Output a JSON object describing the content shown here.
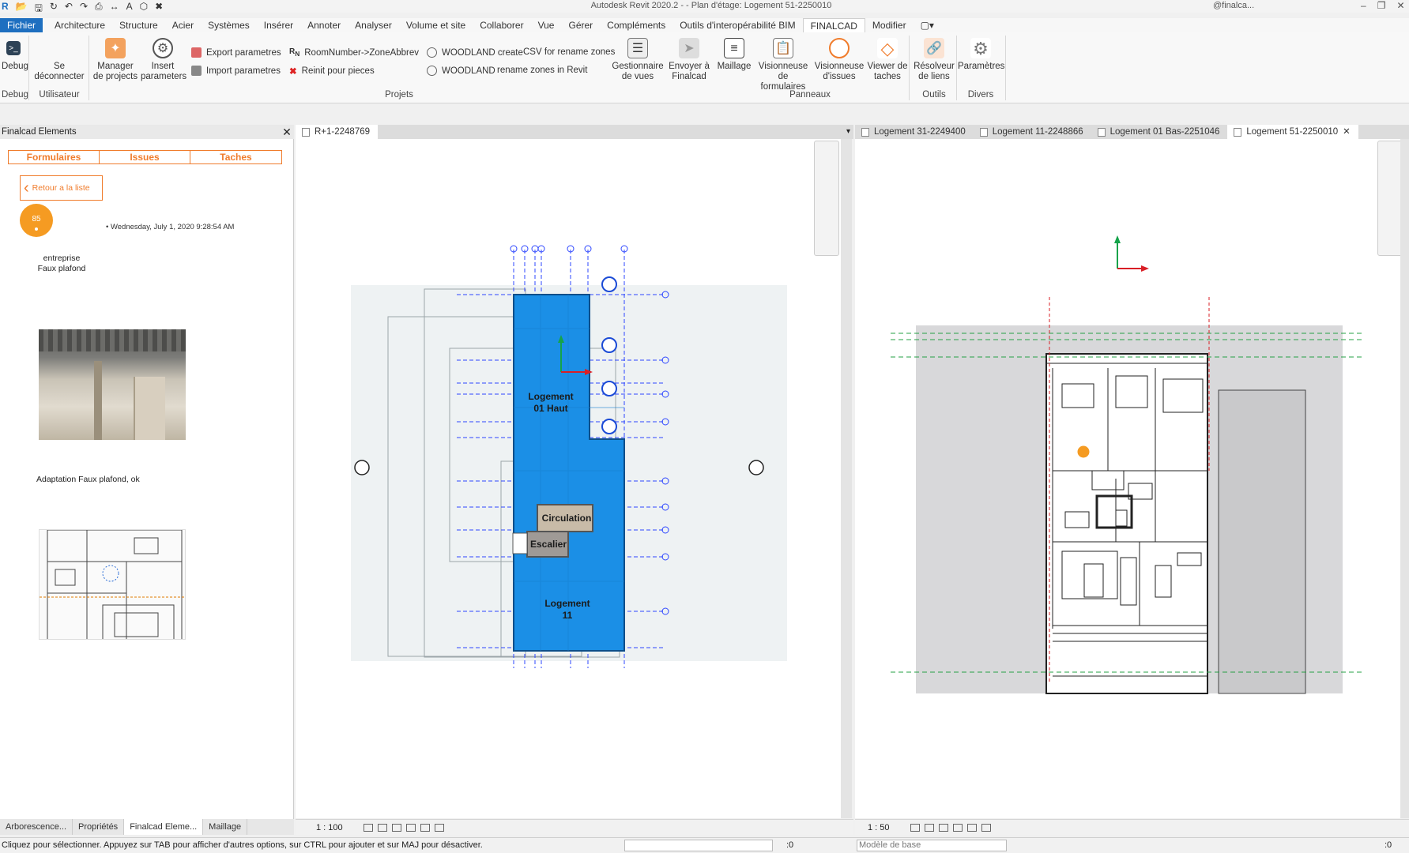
{
  "window": {
    "title": "Autodesk Revit 2020.2 -    - Plan d'étage: Logement 51-2250010",
    "user": "@finalca..."
  },
  "menu_tabs": [
    "Fichier",
    "Architecture",
    "Structure",
    "Acier",
    "Systèmes",
    "Insérer",
    "Annoter",
    "Analyser",
    "Volume et site",
    "Collaborer",
    "Vue",
    "Gérer",
    "Compléments",
    "Outils d'interopérabilité BIM",
    "FINALCAD",
    "Modifier"
  ],
  "ribbon": {
    "debug_label": "Debug",
    "disconnect_label": "Se déconnecter",
    "manage_projects_label": "Manager de projects",
    "insert_params_label": "Insert parameters",
    "export_params": "Export  parametres",
    "import_params": "Import  parametres",
    "roomnumber": "RoomNumber->ZoneAbbrev",
    "reinit": "Reinit  pour pieces",
    "woodland_create": "WOODLAND create",
    "csv_rename": "CSV for rename zones",
    "woodland2": "WOODLAND",
    "rename_zones": "rename zones in Revit",
    "views_manager_label": "Gestionnaire de vues",
    "send_finalcad_label": "Envoyer à Finalcad",
    "mesh_label": "Maillage",
    "forms_viewer_label": "Visionneuse de formulaires",
    "issues_viewer_label": "Visionneuse d'issues",
    "tasks_viewer_label": "Viewer de taches",
    "link_resolver_label": "Résolveur de liens",
    "settings_label": "Paramètres",
    "panels": {
      "debug": "Debug",
      "user": "Utilisateur",
      "projects": "Projets",
      "panels": "Panneaux",
      "tools": "Outils",
      "misc": "Divers"
    }
  },
  "left_panel": {
    "title": "Finalcad Elements",
    "tabs": [
      "Formulaires",
      "Issues",
      "Taches"
    ],
    "back": "Retour a la liste",
    "avatar": "85",
    "date": "• Wednesday, July 1, 2020 9:28:54 AM",
    "company_line1": "entreprise",
    "company_line2": "Faux plafond",
    "comment": "Adaptation Faux plafond, ok",
    "bottom_tabs": [
      "Arborescence...",
      "Propriétés",
      "Finalcad Eleme...",
      "Maillage"
    ]
  },
  "view1": {
    "tab": "R+1-2248769",
    "scale": "1 : 100",
    "room_a": "Logement 01 Haut",
    "room_b": "Circulation",
    "room_c": "Escalier",
    "room_d": "Logement 11"
  },
  "view2": {
    "tabs": [
      "Logement 31-2249400",
      "Logement 11-2248866",
      "Logement 01 Bas-2251046",
      "Logement 51-2250010"
    ],
    "scale": "1 : 50"
  },
  "status": {
    "message": "Cliquez pour sélectionner. Appuyez sur TAB pour afficher d'autres options, sur CTRL pour ajouter et sur MAJ pour désactiver.",
    "zero": ":0",
    "model": "Modèle de base",
    "filter": ":0"
  },
  "colors": {
    "revit_blue": "#1e6fc0",
    "finalcad_orange": "#f07c2c",
    "room_blue": "#1b8fe6"
  }
}
